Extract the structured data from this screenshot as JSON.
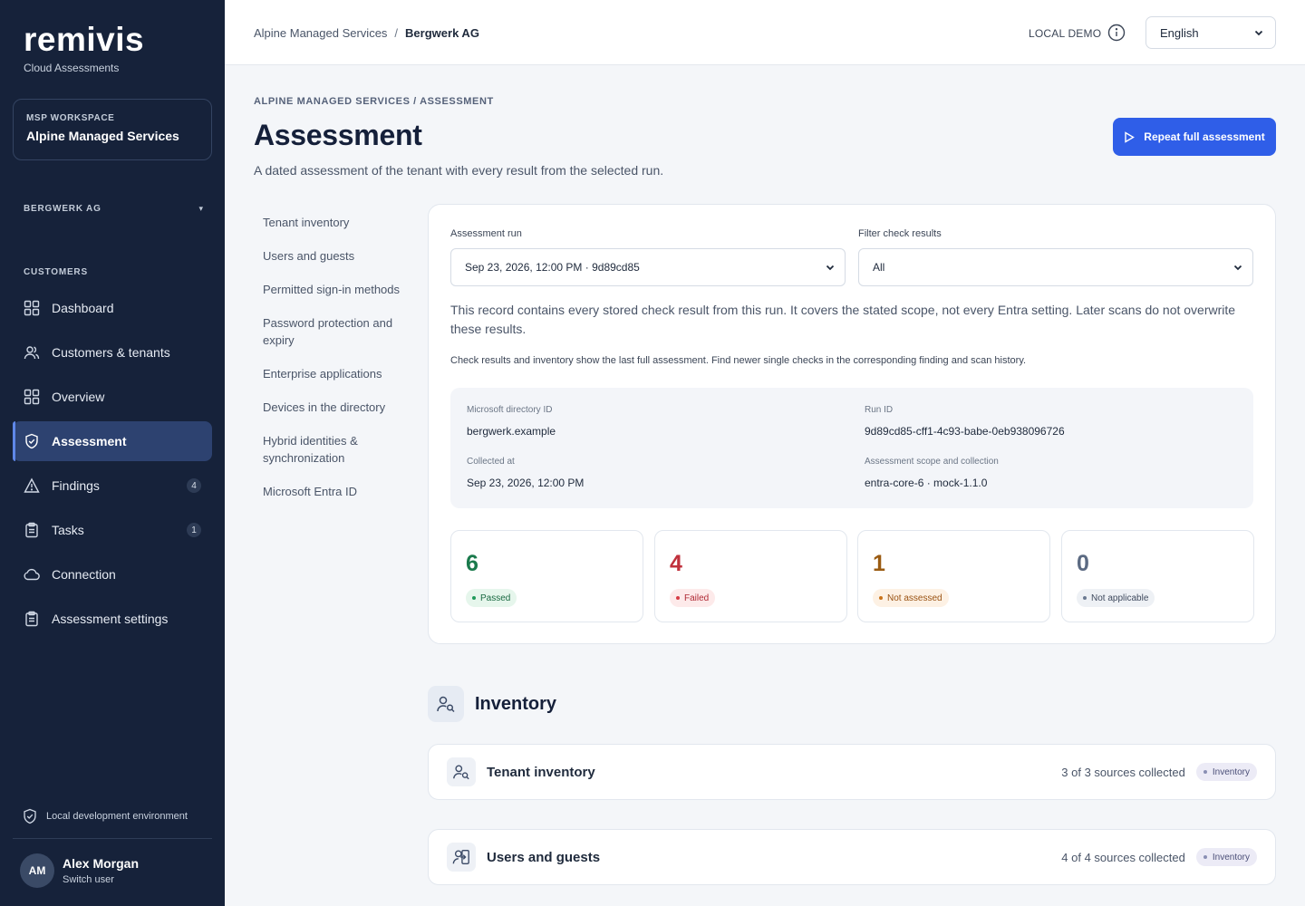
{
  "brand": {
    "name": "remivis",
    "subtitle": "Cloud Assessments"
  },
  "workspace": {
    "label": "MSP WORKSPACE",
    "name": "Alpine Managed Services"
  },
  "tenant_switch": {
    "label": "BERGWERK AG"
  },
  "sidebar": {
    "section_label": "CUSTOMERS",
    "items": [
      {
        "label": "Dashboard",
        "icon": "grid-icon"
      },
      {
        "label": "Customers & tenants",
        "icon": "users-icon"
      },
      {
        "label": "Overview",
        "icon": "grid-icon"
      },
      {
        "label": "Assessment",
        "icon": "shield-check-icon",
        "active": true
      },
      {
        "label": "Findings",
        "icon": "warning-icon",
        "badge": "4"
      },
      {
        "label": "Tasks",
        "icon": "clipboard-icon",
        "badge": "1"
      },
      {
        "label": "Connection",
        "icon": "cloud-icon"
      },
      {
        "label": "Assessment settings",
        "icon": "clipboard-icon"
      }
    ],
    "environment": "Local development environment",
    "user": {
      "initials": "AM",
      "name": "Alex Morgan",
      "action": "Switch user"
    }
  },
  "header": {
    "breadcrumb": [
      "Alpine Managed Services",
      "Bergwerk AG"
    ],
    "mode": "LOCAL DEMO",
    "language": "English"
  },
  "page": {
    "overline": "ALPINE MANAGED SERVICES / ASSESSMENT",
    "title": "Assessment",
    "description": "A dated assessment of the tenant with every result from the selected run.",
    "primary_action": "Repeat full assessment"
  },
  "subnav": [
    "Tenant inventory",
    "Users and guests",
    "Permitted sign-in methods",
    "Password protection and expiry",
    "Enterprise applications",
    "Devices in the directory",
    "Hybrid identities & synchronization",
    "Microsoft Entra ID"
  ],
  "run_card": {
    "run_label": "Assessment run",
    "run_value": "Sep 23, 2026, 12:00 PM · 9d89cd85",
    "filter_label": "Filter check results",
    "filter_value": "All",
    "note": "This record contains every stored check result from this run. It covers the stated scope, not every Entra setting. Later scans do not overwrite these results.",
    "note2": "Check results and inventory show the last full assessment. Find newer single checks in the corresponding finding and scan history.",
    "meta": {
      "directory_id_label": "Microsoft directory ID",
      "directory_id": "bergwerk.example",
      "run_id_label": "Run ID",
      "run_id": "9d89cd85-cff1-4c93-babe-0eb938096726",
      "collected_label": "Collected at",
      "collected": "Sep 23, 2026, 12:00 PM",
      "scope_label": "Assessment scope and collection",
      "scope": "entra-core-6 · mock-1.1.0"
    },
    "stats": [
      {
        "value": "6",
        "label": "Passed",
        "color": "#1a7a4c",
        "bg": "#e6f6ec",
        "dot": "#1f9a5a"
      },
      {
        "value": "4",
        "label": "Failed",
        "color": "#c0313c",
        "bg": "#fdeaea",
        "dot": "#d63c46"
      },
      {
        "value": "1",
        "label": "Not assessed",
        "color": "#9a5b12",
        "bg": "#fdf1e4",
        "dot": "#c9731a"
      },
      {
        "value": "0",
        "label": "Not applicable",
        "color": "#5b6a82",
        "bg": "#eef1f5",
        "dot": "#6b7a92"
      }
    ]
  },
  "inventory": {
    "title": "Inventory",
    "rows": [
      {
        "title": "Tenant inventory",
        "count": "3 of 3 sources collected",
        "tag": "Inventory"
      },
      {
        "title": "Users and guests",
        "count": "4 of 4 sources collected",
        "tag": "Inventory"
      }
    ]
  },
  "colors": {
    "sidebar": "#16223a",
    "accent": "#2f5ee8",
    "active_nav": "#2d4270"
  }
}
